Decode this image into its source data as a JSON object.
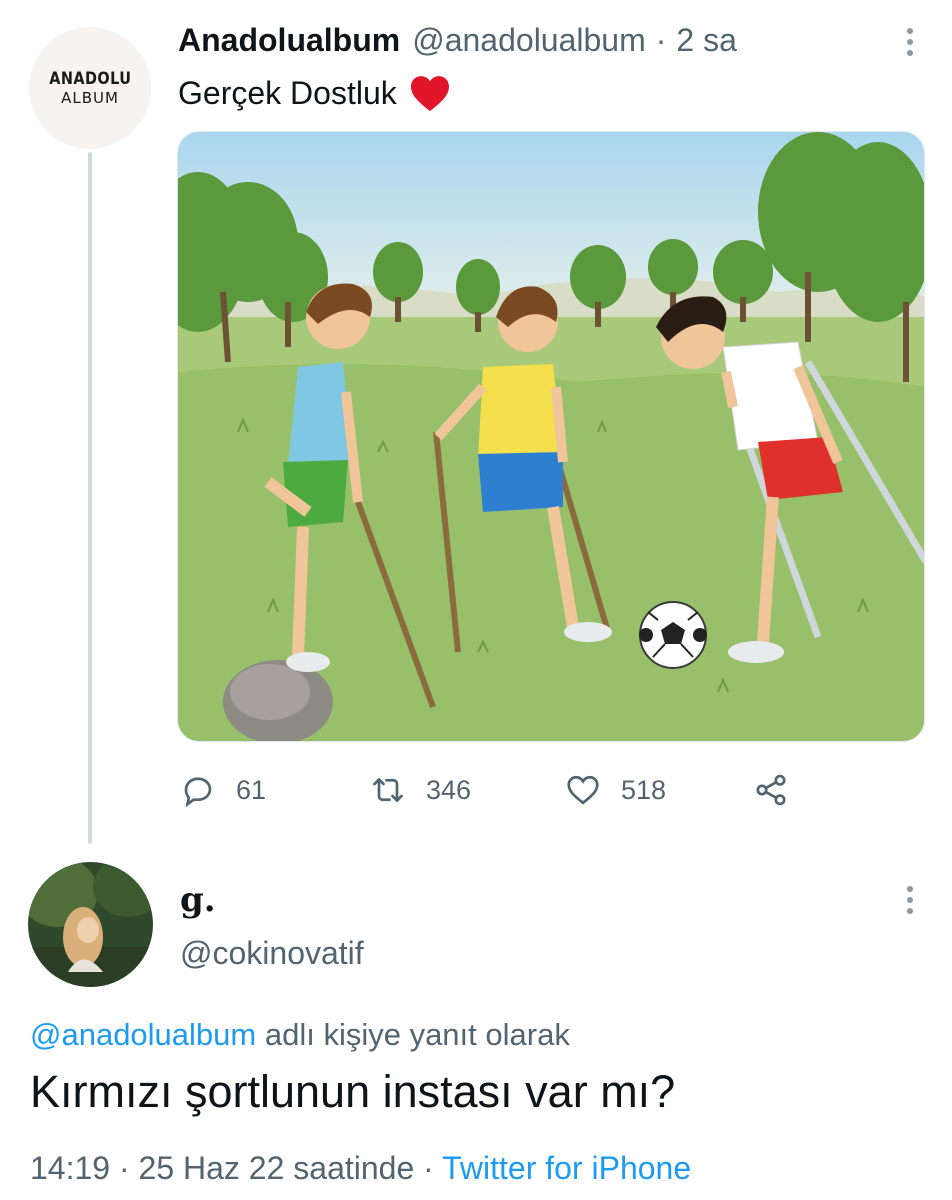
{
  "tweet": {
    "avatar": {
      "line1": "ANADOLU",
      "line2": "ALBUM"
    },
    "display_name": "Anadolualbum",
    "handle": "@anadolualbum",
    "separator": "·",
    "time": "2 sa",
    "text": "Gerçek Dostluk",
    "emoji": "red-heart-icon",
    "media": {
      "type": "illustration",
      "description_icon": "image-icon"
    },
    "actions": {
      "reply": {
        "icon": "reply-icon",
        "count": "61"
      },
      "retweet": {
        "icon": "retweet-icon",
        "count": "346"
      },
      "like": {
        "icon": "like-icon",
        "count": "518"
      },
      "share": {
        "icon": "share-icon"
      }
    }
  },
  "reply": {
    "display_name": "g.",
    "handle": "@cokinovatif",
    "reply_to_mention": "@anadolualbum",
    "reply_to_suffix": " adlı kişiye yanıt olarak",
    "text": "Kırmızı şortlunun instası var mı?",
    "meta_time": "14:19",
    "meta_sep1": " · ",
    "meta_date": "25 Haz 22 saatinde",
    "meta_sep2": " · ",
    "meta_source": "Twitter for iPhone"
  },
  "colors": {
    "accent": "#1d9bf0",
    "secondary_text": "#536471",
    "primary_text": "#0f1419",
    "heart": "#f4212e",
    "thread_line": "#cfd9de"
  }
}
